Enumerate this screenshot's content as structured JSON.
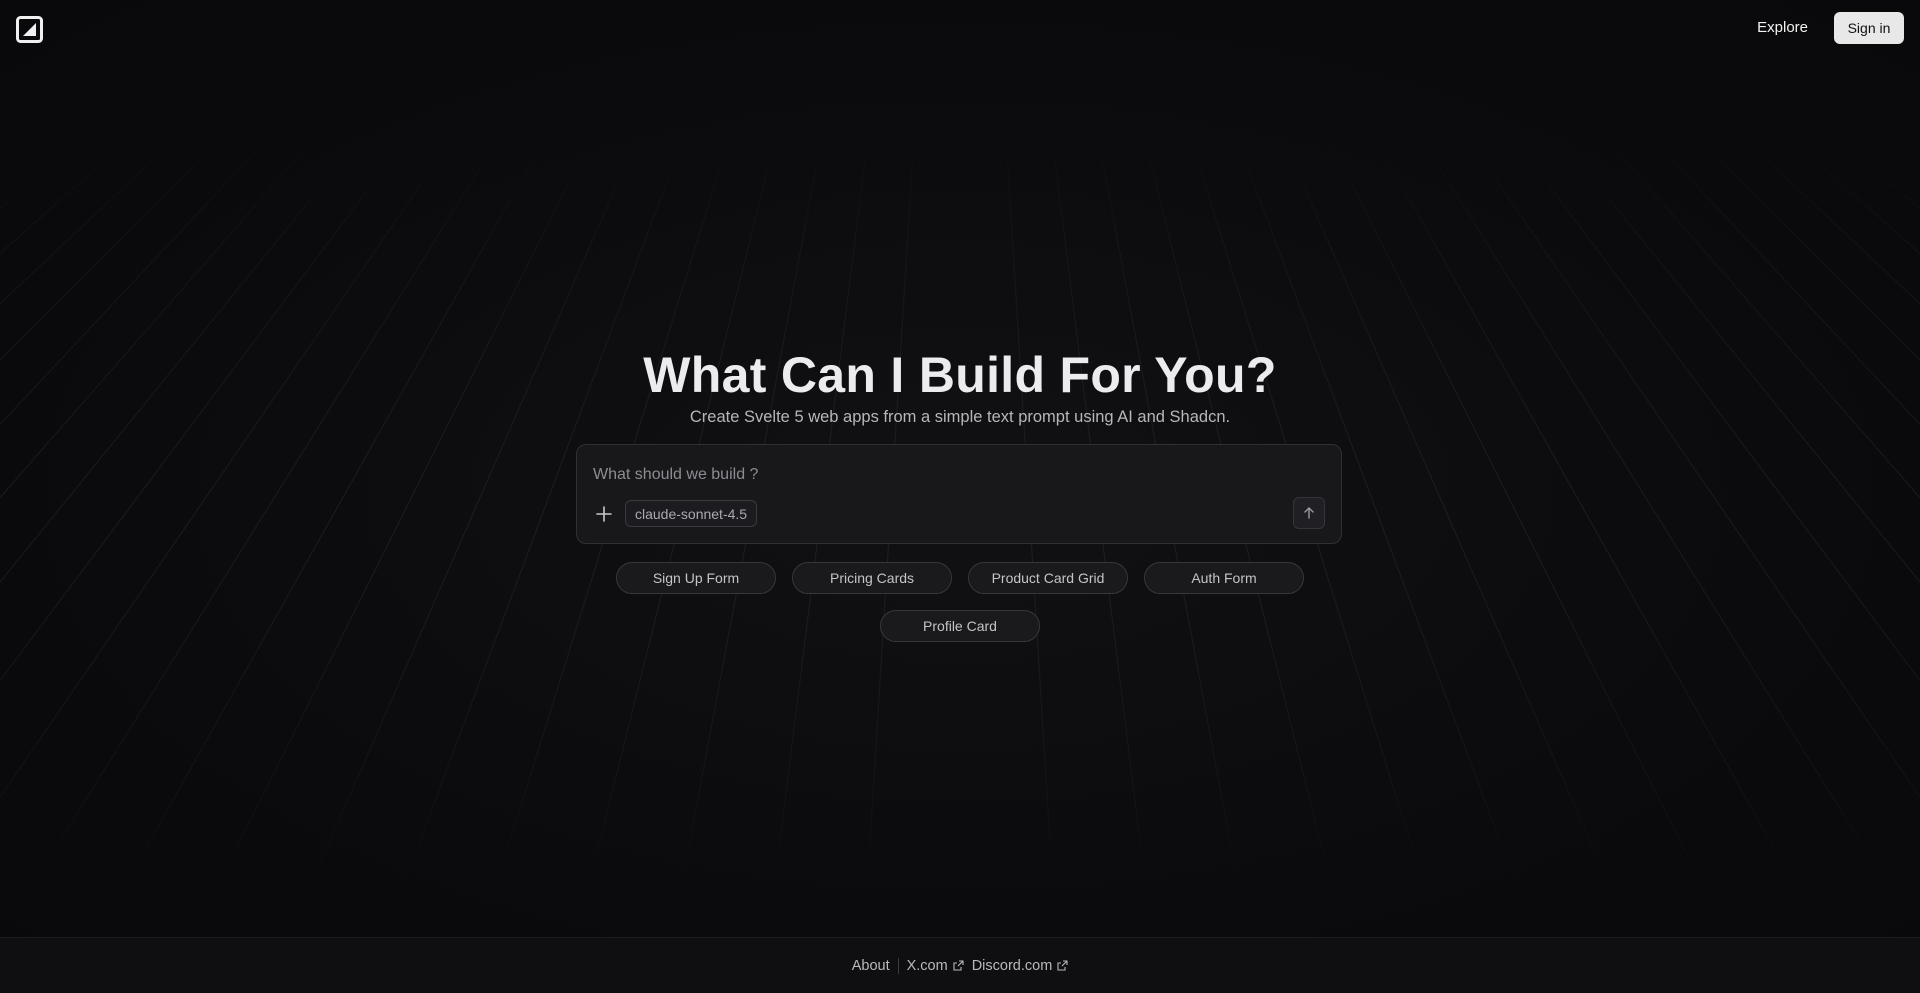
{
  "header": {
    "logo_icon": "app-logo-icon",
    "nav_explore": "Explore",
    "signin_label": "Sign in"
  },
  "hero": {
    "title": "What Can I Build For You?",
    "subtitle": "Create Svelte 5 web apps from a simple text prompt using AI and Shadcn."
  },
  "prompt": {
    "placeholder": "What should we build ?",
    "value": "",
    "model": "claude-sonnet-4.5",
    "add_icon": "plus-icon",
    "send_icon": "arrow-up-icon"
  },
  "suggestions": [
    "Sign Up Form",
    "Pricing Cards",
    "Product Card Grid",
    "Auth Form",
    "Profile Card"
  ],
  "footer": {
    "about": "About",
    "x": "X.com",
    "discord": "Discord.com",
    "external_icon": "external-link-icon"
  },
  "colors": {
    "background": "#0b0b0d",
    "surface": "#18181b",
    "border": "#2f2f34",
    "signin_bg": "#e8e8e8",
    "text_primary": "#ececee",
    "text_muted": "#b6b6bb"
  }
}
